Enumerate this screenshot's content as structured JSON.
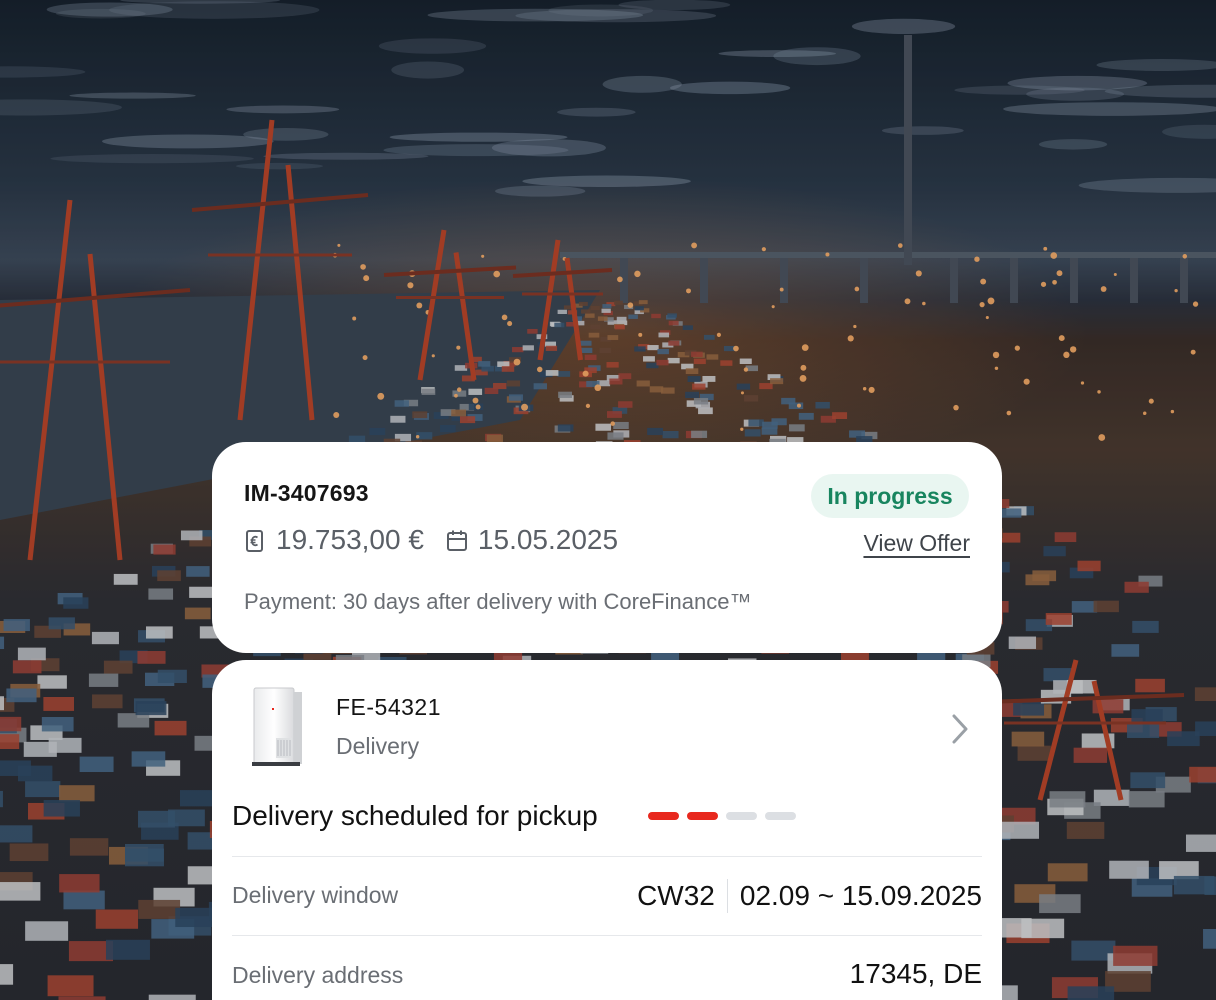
{
  "background": {
    "scene": "container-port-at-dusk-photo",
    "colors": {
      "sky": "#2a3848",
      "lights": "#ff8a3d",
      "cranes": "#b8452a"
    }
  },
  "offer": {
    "id": "IM-3407693",
    "status": "In progress",
    "amount": "19.753,00 €",
    "date": "15.05.2025",
    "view_offer_label": "View Offer",
    "payment_text": "Payment: 30 days after delivery with CoreFinance™",
    "icons": {
      "amount": "invoice-euro-icon",
      "date": "calendar-icon"
    },
    "colors": {
      "status_text": "#18855f",
      "status_bg": "#e9f6f1"
    }
  },
  "delivery": {
    "product_id": "FE-54321",
    "product_type": "Delivery",
    "status_text": "Delivery scheduled for pickup",
    "progress": {
      "completed": 2,
      "total": 4,
      "active_color": "#e8281e"
    },
    "rows": [
      {
        "label": "Delivery window",
        "week": "CW32",
        "value": "02.09 ~ 15.09.2025"
      },
      {
        "label": "Delivery address",
        "value": "17345, DE"
      }
    ],
    "icons": {
      "product": "battery-storage-unit-image",
      "navigate": "chevron-right-icon"
    }
  }
}
